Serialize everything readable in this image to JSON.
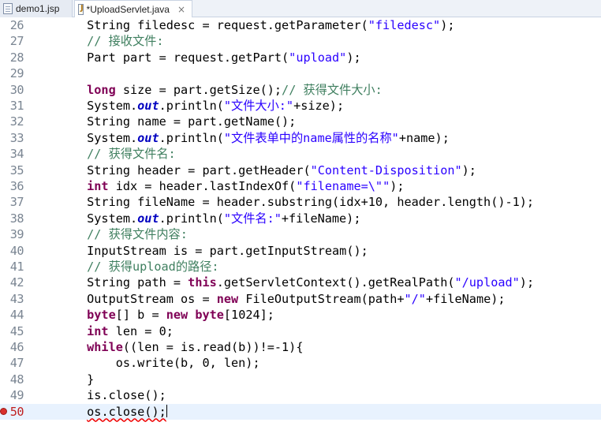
{
  "tabs": [
    {
      "label": "demo1.jsp",
      "icon": "jsp-file-icon",
      "active": false
    },
    {
      "label": "*UploadServlet.java",
      "icon": "java-file-icon",
      "active": true,
      "close": "×"
    }
  ],
  "lines": [
    {
      "n": "26",
      "tokens": [
        [
          "p",
          "        String filedesc = request.getParameter("
        ],
        [
          "s",
          "\"filedesc\""
        ],
        [
          "p",
          ");"
        ]
      ]
    },
    {
      "n": "27",
      "tokens": [
        [
          "c",
          "        // 接收文件:"
        ]
      ]
    },
    {
      "n": "28",
      "tokens": [
        [
          "p",
          "        Part part = request.getPart("
        ],
        [
          "s",
          "\"upload\""
        ],
        [
          "p",
          ");"
        ]
      ]
    },
    {
      "n": "29",
      "tokens": [
        [
          "p",
          ""
        ]
      ]
    },
    {
      "n": "30",
      "tokens": [
        [
          "k",
          "        long"
        ],
        [
          "p",
          " size = part.getSize();"
        ],
        [
          "c",
          "// 获得文件大小:"
        ]
      ]
    },
    {
      "n": "31",
      "tokens": [
        [
          "p",
          "        System."
        ],
        [
          "f",
          "out"
        ],
        [
          "p",
          ".println("
        ],
        [
          "s",
          "\"文件大小:\""
        ],
        [
          "p",
          "+size);"
        ]
      ]
    },
    {
      "n": "32",
      "tokens": [
        [
          "p",
          "        String name = part.getName();"
        ]
      ]
    },
    {
      "n": "33",
      "tokens": [
        [
          "p",
          "        System."
        ],
        [
          "f",
          "out"
        ],
        [
          "p",
          ".println("
        ],
        [
          "s",
          "\"文件表单中的name属性的名称\""
        ],
        [
          "p",
          "+name);"
        ]
      ]
    },
    {
      "n": "34",
      "tokens": [
        [
          "c",
          "        // 获得文件名:"
        ]
      ]
    },
    {
      "n": "35",
      "tokens": [
        [
          "p",
          "        String header = part.getHeader("
        ],
        [
          "s",
          "\"Content-Disposition\""
        ],
        [
          "p",
          ");"
        ]
      ]
    },
    {
      "n": "36",
      "tokens": [
        [
          "k",
          "        int"
        ],
        [
          "p",
          " idx = header.lastIndexOf("
        ],
        [
          "s",
          "\"filename=\\\"\""
        ],
        [
          "p",
          ");"
        ]
      ]
    },
    {
      "n": "37",
      "tokens": [
        [
          "p",
          "        String fileName = header.substring(idx+10, header.length()-1);"
        ]
      ]
    },
    {
      "n": "38",
      "tokens": [
        [
          "p",
          "        System."
        ],
        [
          "f",
          "out"
        ],
        [
          "p",
          ".println("
        ],
        [
          "s",
          "\"文件名:\""
        ],
        [
          "p",
          "+fileName);"
        ]
      ]
    },
    {
      "n": "39",
      "tokens": [
        [
          "c",
          "        // 获得文件内容:"
        ]
      ]
    },
    {
      "n": "40",
      "tokens": [
        [
          "p",
          "        InputStream is = part.getInputStream();"
        ]
      ]
    },
    {
      "n": "41",
      "tokens": [
        [
          "c",
          "        // 获得upload的路径:"
        ]
      ]
    },
    {
      "n": "42",
      "tokens": [
        [
          "p",
          "        String path = "
        ],
        [
          "k",
          "this"
        ],
        [
          "p",
          ".getServletContext().getRealPath("
        ],
        [
          "s",
          "\"/upload\""
        ],
        [
          "p",
          ");"
        ]
      ]
    },
    {
      "n": "43",
      "tokens": [
        [
          "p",
          "        OutputStream os = "
        ],
        [
          "k",
          "new"
        ],
        [
          "p",
          " FileOutputStream(path+"
        ],
        [
          "s",
          "\"/\""
        ],
        [
          "p",
          "+fileName);"
        ]
      ]
    },
    {
      "n": "44",
      "tokens": [
        [
          "k",
          "        byte"
        ],
        [
          "p",
          "[] b = "
        ],
        [
          "k",
          "new byte"
        ],
        [
          "p",
          "[1024];"
        ]
      ]
    },
    {
      "n": "45",
      "tokens": [
        [
          "k",
          "        int"
        ],
        [
          "p",
          " len = 0;"
        ]
      ]
    },
    {
      "n": "46",
      "tokens": [
        [
          "k",
          "        while"
        ],
        [
          "p",
          "((len = is.read(b))!=-1){"
        ]
      ]
    },
    {
      "n": "47",
      "tokens": [
        [
          "p",
          "            os.write(b, 0, len);"
        ]
      ]
    },
    {
      "n": "48",
      "tokens": [
        [
          "p",
          "        }"
        ]
      ]
    },
    {
      "n": "49",
      "tokens": [
        [
          "p",
          "        is.close();"
        ]
      ]
    },
    {
      "n": "50",
      "tokens": [
        [
          "p",
          "        "
        ],
        [
          "e",
          "os.close();"
        ]
      ],
      "current": true,
      "error": true
    }
  ]
}
